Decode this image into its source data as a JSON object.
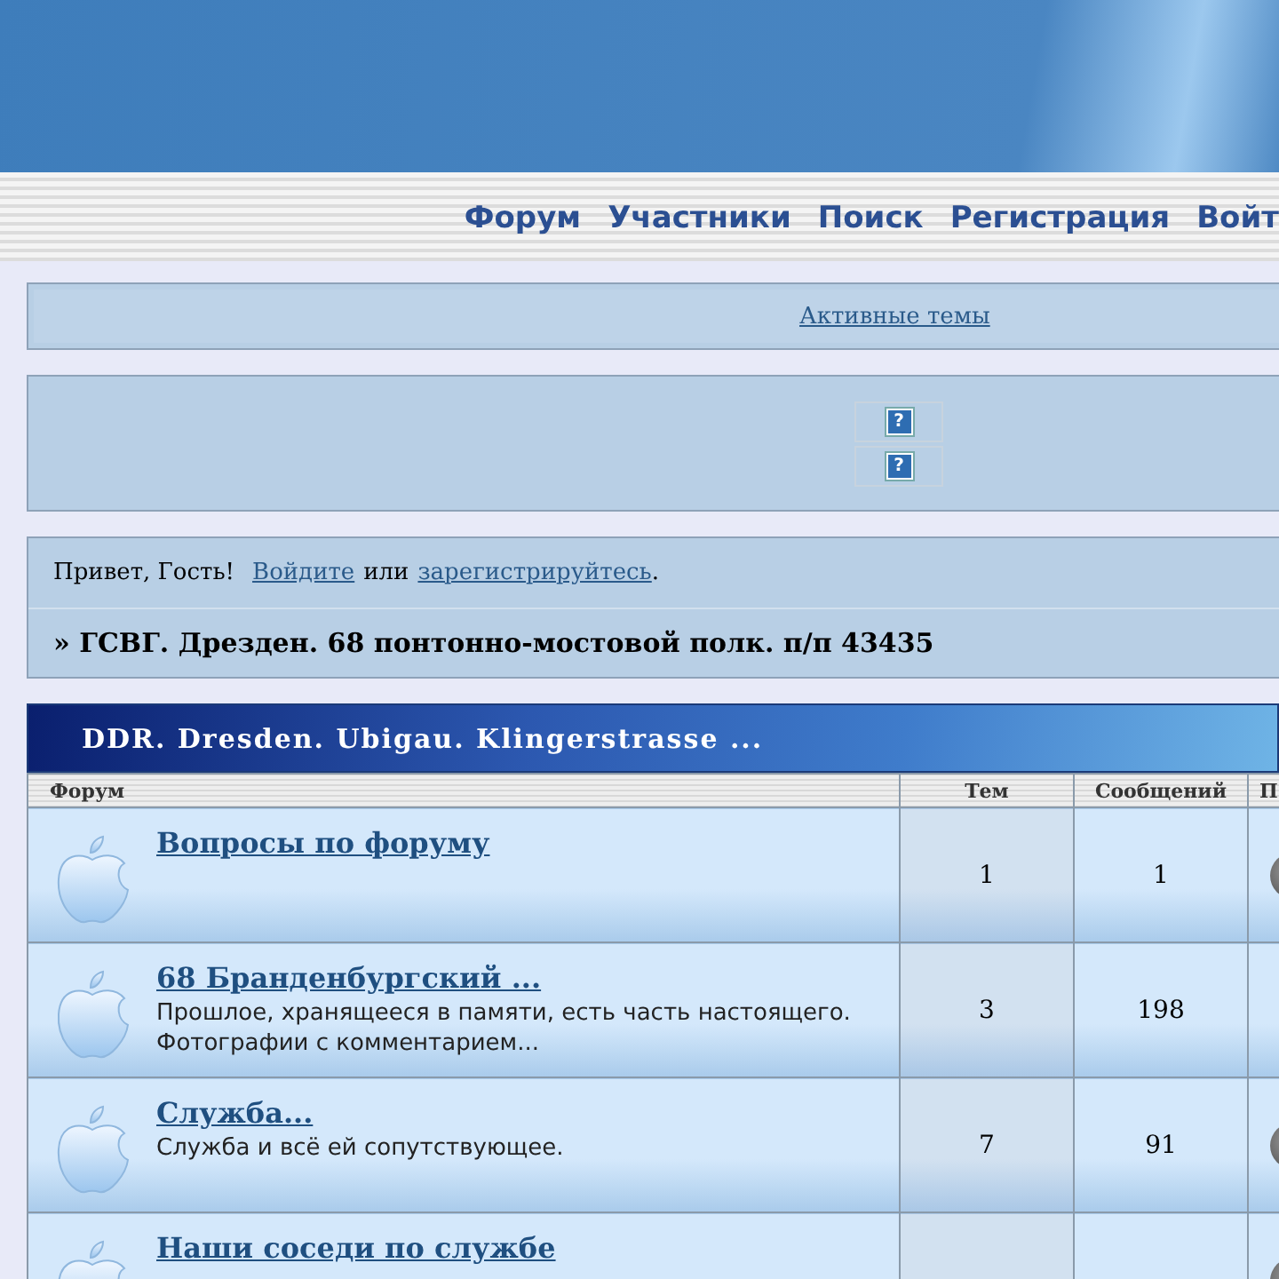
{
  "nav": [
    "Форум",
    "Участники",
    "Поиск",
    "Регистрация",
    "Войт"
  ],
  "active_topics": "Активные темы",
  "help_icons": [
    "?",
    "?"
  ],
  "greeting": {
    "text": "Привет, Гость!",
    "login": "Войдите",
    "or": "или",
    "register": "зарегистрируйтесь",
    "end": "."
  },
  "breadcrumb": "» ГСВГ. Дрезден. 68 понтонно-мостовой полк. п/п 43435",
  "category": "DDR. Dresden. Ubigau. Klingerstrasse ...",
  "table": {
    "columns": [
      "Форум",
      "Тем",
      "Сообщений",
      "П"
    ],
    "rows": [
      {
        "title": "Вопросы по форуму",
        "topics": "1",
        "posts": "1",
        "last_post_avatar": true
      },
      {
        "title": "68 Бранденбургский ...",
        "description": "Прошлое, хранящееся в памяти, есть часть настоящего. Фотографии с комментарием...",
        "topics": "3",
        "posts": "198",
        "last_post_avatar": false
      },
      {
        "title": "Служба...",
        "description": "Служба и всё ей сопутствующее.",
        "topics": "7",
        "posts": "91",
        "last_post_avatar": true
      },
      {
        "title": "Наши соседи по службе",
        "last_post_avatar": true
      }
    ]
  }
}
